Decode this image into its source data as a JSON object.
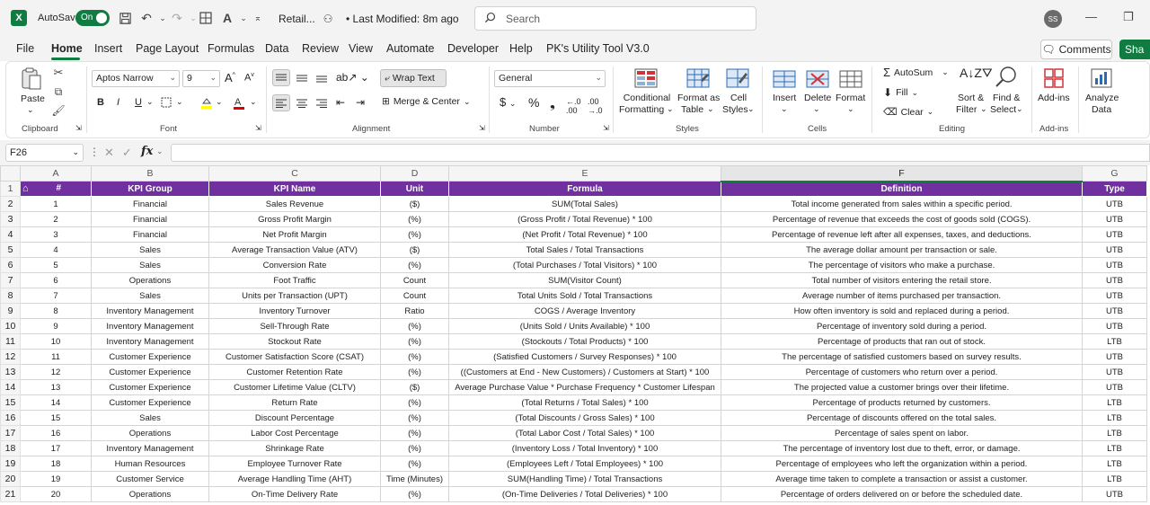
{
  "titlebar": {
    "autosave_label": "AutoSave",
    "autosave_state": "On",
    "doc_title": "Retail...",
    "last_modified": "• Last Modified: 8m ago",
    "search_placeholder": "Search",
    "user_initials": "SS",
    "brand_color": "#107c41"
  },
  "menu": {
    "tabs": [
      "File",
      "Home",
      "Insert",
      "Page Layout",
      "Formulas",
      "Data",
      "Review",
      "View",
      "Automate",
      "Developer",
      "Help",
      "PK's Utility Tool V3.0"
    ],
    "active": "Home",
    "comments_label": "Comments",
    "share_label": "Sha"
  },
  "ribbon": {
    "clipboard": {
      "label": "Clipboard",
      "paste": "Paste"
    },
    "font": {
      "label": "Font",
      "family": "Aptos Narrow",
      "size": "9"
    },
    "alignment": {
      "label": "Alignment",
      "wrap_text": "Wrap Text",
      "merge_center": "Merge & Center"
    },
    "number": {
      "label": "Number",
      "format": "General"
    },
    "styles": {
      "label": "Styles",
      "conditional": [
        "Conditional",
        "Formatting"
      ],
      "format_as": [
        "Format as",
        "Table"
      ],
      "cell_styles": [
        "Cell",
        "Styles"
      ]
    },
    "cells": {
      "label": "Cells",
      "insert": "Insert",
      "delete": "Delete",
      "format": "Format"
    },
    "editing": {
      "label": "Editing",
      "autosum": "AutoSum",
      "fill": "Fill",
      "clear": "Clear",
      "sort_filter": [
        "Sort &",
        "Filter"
      ],
      "find_select": [
        "Find &",
        "Select"
      ]
    },
    "addins": {
      "label": "Add-ins",
      "addins": "Add-ins"
    },
    "analyze": {
      "label": [
        "Analyze",
        "Data"
      ]
    }
  },
  "formula_bar": {
    "name_box": "F26",
    "fx": "fx",
    "value": ""
  },
  "sheet": {
    "columns": [
      "A",
      "B",
      "C",
      "D",
      "E",
      "F",
      "G"
    ],
    "selected_column": "F",
    "header_color": "#7030a0",
    "headers": [
      "#",
      "KPI Group",
      "KPI Name",
      "Unit",
      "Formula",
      "Definition",
      "Type"
    ],
    "rows": [
      [
        "1",
        "Financial",
        "Sales Revenue",
        "($)",
        "SUM(Total Sales)",
        "Total income generated from sales within a specific period.",
        "UTB"
      ],
      [
        "2",
        "Financial",
        "Gross Profit Margin",
        "(%)",
        "(Gross Profit / Total Revenue) * 100",
        "Percentage of revenue that exceeds the cost of goods sold (COGS).",
        "UTB"
      ],
      [
        "3",
        "Financial",
        "Net Profit Margin",
        "(%)",
        "(Net Profit / Total Revenue) * 100",
        "Percentage of revenue left after all expenses, taxes, and deductions.",
        "UTB"
      ],
      [
        "4",
        "Sales",
        "Average Transaction Value (ATV)",
        "($)",
        "Total Sales / Total Transactions",
        "The average dollar amount per transaction or sale.",
        "UTB"
      ],
      [
        "5",
        "Sales",
        "Conversion Rate",
        "(%)",
        "(Total Purchases / Total Visitors) * 100",
        "The percentage of visitors who make a purchase.",
        "UTB"
      ],
      [
        "6",
        "Operations",
        "Foot Traffic",
        "Count",
        "SUM(Visitor Count)",
        "Total number of visitors entering the retail store.",
        "UTB"
      ],
      [
        "7",
        "Sales",
        "Units per Transaction (UPT)",
        "Count",
        "Total Units Sold / Total Transactions",
        "Average number of items purchased per transaction.",
        "UTB"
      ],
      [
        "8",
        "Inventory Management",
        "Inventory Turnover",
        "Ratio",
        "COGS / Average Inventory",
        "How often inventory is sold and replaced during a period.",
        "UTB"
      ],
      [
        "9",
        "Inventory Management",
        "Sell-Through Rate",
        "(%)",
        "(Units Sold / Units Available) * 100",
        "Percentage of inventory sold during a period.",
        "UTB"
      ],
      [
        "10",
        "Inventory Management",
        "Stockout Rate",
        "(%)",
        "(Stockouts / Total Products) * 100",
        "Percentage of products that ran out of stock.",
        "LTB"
      ],
      [
        "11",
        "Customer Experience",
        "Customer Satisfaction Score (CSAT)",
        "(%)",
        "(Satisfied Customers / Survey Responses) * 100",
        "The percentage of satisfied customers based on survey results.",
        "UTB"
      ],
      [
        "12",
        "Customer Experience",
        "Customer Retention Rate",
        "(%)",
        "((Customers at End - New Customers) / Customers at Start) * 100",
        "Percentage of customers who return over a period.",
        "UTB"
      ],
      [
        "13",
        "Customer Experience",
        "Customer Lifetime Value (CLTV)",
        "($)",
        "Average Purchase Value * Purchase Frequency * Customer Lifespan",
        "The projected value a customer brings over their lifetime.",
        "UTB"
      ],
      [
        "14",
        "Customer Experience",
        "Return Rate",
        "(%)",
        "(Total Returns / Total Sales) * 100",
        "Percentage of products returned by customers.",
        "LTB"
      ],
      [
        "15",
        "Sales",
        "Discount Percentage",
        "(%)",
        "(Total Discounts / Gross Sales) * 100",
        "Percentage of discounts offered on the total sales.",
        "LTB"
      ],
      [
        "16",
        "Operations",
        "Labor Cost Percentage",
        "(%)",
        "(Total Labor Cost / Total Sales) * 100",
        "Percentage of sales spent on labor.",
        "LTB"
      ],
      [
        "17",
        "Inventory Management",
        "Shrinkage Rate",
        "(%)",
        "(Inventory Loss / Total Inventory) * 100",
        "The percentage of inventory lost due to theft, error, or damage.",
        "LTB"
      ],
      [
        "18",
        "Human Resources",
        "Employee Turnover Rate",
        "(%)",
        "(Employees Left / Total Employees) * 100",
        "Percentage of employees who left the organization within a period.",
        "LTB"
      ],
      [
        "19",
        "Customer Service",
        "Average Handling Time (AHT)",
        "Time (Minutes)",
        "SUM(Handling Time) / Total Transactions",
        "Average time taken to complete a transaction or assist a customer.",
        "LTB"
      ],
      [
        "20",
        "Operations",
        "On-Time Delivery Rate",
        "(%)",
        "(On-Time Deliveries / Total Deliveries) * 100",
        "Percentage of orders delivered on or before the scheduled date.",
        "UTB"
      ]
    ]
  }
}
